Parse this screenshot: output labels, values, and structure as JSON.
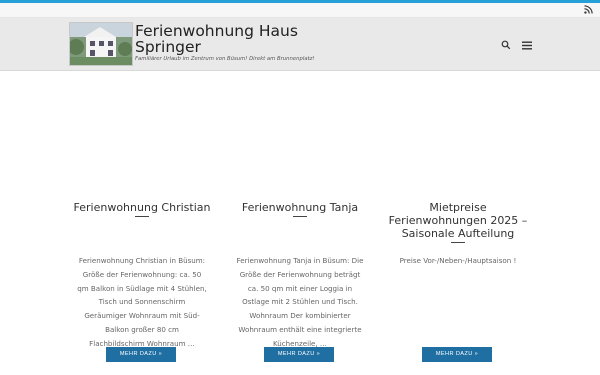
{
  "site": {
    "title": "Ferienwohnung Haus Springer",
    "tagline": "Familiärer Urlaub im Zentrum von Büsum! Direkt am Brunnenplatz!"
  },
  "colors": {
    "accent": "#27a0d8",
    "button": "#1f6fa3"
  },
  "icons": {
    "topbar": "rss-icon",
    "search": "search-icon",
    "menu": "hamburger-menu-icon"
  },
  "posts": [
    {
      "title": "Ferienwohnung Christian",
      "excerpt_lines": [
        "Ferienwohnung Christian in Büsum:",
        "Größe der Ferienwohnung: ca. 50",
        "qm Balkon in Südlage mit 4 Stühlen,",
        "Tisch und Sonnenschirm",
        "Geräumiger Wohnraum mit Süd-",
        "Balkon großer 80 cm",
        "Flachbildschirm Wohnraum …"
      ],
      "button": "MEHR DAZU »"
    },
    {
      "title": "Ferienwohnung Tanja",
      "excerpt_lines": [
        "Ferienwohnung Tanja in Büsum: Die",
        "Größe der Ferienwohnung beträgt",
        "ca. 50 qm mit einer Loggia in",
        "Ostlage mit 2 Stühlen und Tisch.",
        "Wohnraum Der kombinierter",
        "Wohnraum enthält eine integrierte",
        "Küchenzeile, …"
      ],
      "button": "MEHR DAZU »"
    },
    {
      "title_lines": [
        "Mietpreise",
        "Ferienwohnungen 2025 –",
        "Saisonale Aufteilung"
      ],
      "excerpt_lines": [
        "Preise Vor-/Neben-/Hauptsaison !"
      ],
      "button": "MEHR DAZU »"
    }
  ]
}
